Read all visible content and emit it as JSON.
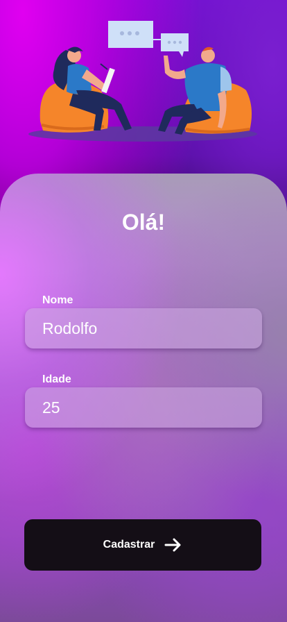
{
  "header": {
    "illustration": "two-people-conversation-illustration",
    "icons": [
      "chat-bubble-icon",
      "chat-bubble-icon"
    ]
  },
  "form": {
    "title": "Olá!",
    "name_label": "Nome",
    "name_value": "Rodolfo",
    "age_label": "Idade",
    "age_value": "25",
    "submit_label": "Cadastrar",
    "submit_icon": "arrow-right-icon"
  },
  "colors": {
    "accent": "#e000f0",
    "button": "#140e16",
    "text": "#ffffff"
  }
}
